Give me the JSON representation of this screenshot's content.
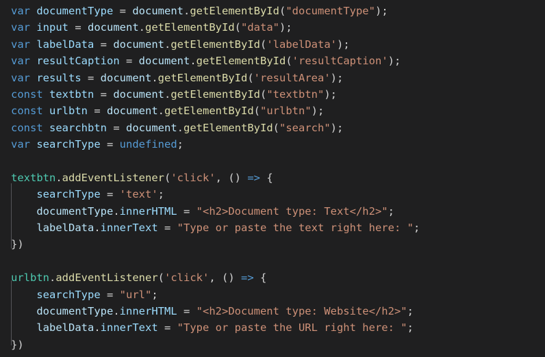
{
  "editor": {
    "language": "javascript",
    "background_color": "#1f1f20",
    "default_text_color": "#d4d4d4",
    "indent_guide_color": "#56565a",
    "font_size_px": 15.5,
    "line_height_px": 24.4,
    "theme_colors": {
      "keyword": "#569cd6",
      "variable": "#9cdcfe",
      "object": "#b9e3f7",
      "function": "#dcdcaa",
      "string": "#ce9178",
      "punctuation": "#d4d4d4",
      "receiver": "#4ec9b0",
      "arrow": "#569cd6"
    }
  },
  "code": {
    "lines": [
      {
        "n": 1,
        "text": "var documentType = document.getElementById(\"documentType\");",
        "tokens": [
          {
            "t": "var",
            "c": "kw"
          },
          {
            "t": " ",
            "c": "punc"
          },
          {
            "t": "documentType",
            "c": "var"
          },
          {
            "t": " = ",
            "c": "op"
          },
          {
            "t": "document",
            "c": "obj"
          },
          {
            "t": ".",
            "c": "punc"
          },
          {
            "t": "getElementById",
            "c": "fn"
          },
          {
            "t": "(",
            "c": "punc"
          },
          {
            "t": "\"documentType\"",
            "c": "str"
          },
          {
            "t": ");",
            "c": "punc"
          }
        ]
      },
      {
        "n": 2,
        "text": "var input = document.getElementById(\"data\");",
        "tokens": [
          {
            "t": "var",
            "c": "kw"
          },
          {
            "t": " ",
            "c": "punc"
          },
          {
            "t": "input",
            "c": "var"
          },
          {
            "t": " = ",
            "c": "op"
          },
          {
            "t": "document",
            "c": "obj"
          },
          {
            "t": ".",
            "c": "punc"
          },
          {
            "t": "getElementById",
            "c": "fn"
          },
          {
            "t": "(",
            "c": "punc"
          },
          {
            "t": "\"data\"",
            "c": "str"
          },
          {
            "t": ");",
            "c": "punc"
          }
        ]
      },
      {
        "n": 3,
        "text": "var labelData = document.getElementById('labelData');",
        "tokens": [
          {
            "t": "var",
            "c": "kw"
          },
          {
            "t": " ",
            "c": "punc"
          },
          {
            "t": "labelData",
            "c": "var"
          },
          {
            "t": " = ",
            "c": "op"
          },
          {
            "t": "document",
            "c": "obj"
          },
          {
            "t": ".",
            "c": "punc"
          },
          {
            "t": "getElementById",
            "c": "fn"
          },
          {
            "t": "(",
            "c": "punc"
          },
          {
            "t": "'labelData'",
            "c": "str"
          },
          {
            "t": ");",
            "c": "punc"
          }
        ]
      },
      {
        "n": 4,
        "text": "var resultCaption = document.getElementById('resultCaption');",
        "tokens": [
          {
            "t": "var",
            "c": "kw"
          },
          {
            "t": " ",
            "c": "punc"
          },
          {
            "t": "resultCaption",
            "c": "var"
          },
          {
            "t": " = ",
            "c": "op"
          },
          {
            "t": "document",
            "c": "obj"
          },
          {
            "t": ".",
            "c": "punc"
          },
          {
            "t": "getElementById",
            "c": "fn"
          },
          {
            "t": "(",
            "c": "punc"
          },
          {
            "t": "'resultCaption'",
            "c": "str"
          },
          {
            "t": ");",
            "c": "punc"
          }
        ]
      },
      {
        "n": 5,
        "text": "var results = document.getElementById('resultArea');",
        "tokens": [
          {
            "t": "var",
            "c": "kw"
          },
          {
            "t": " ",
            "c": "punc"
          },
          {
            "t": "results",
            "c": "var"
          },
          {
            "t": " = ",
            "c": "op"
          },
          {
            "t": "document",
            "c": "obj"
          },
          {
            "t": ".",
            "c": "punc"
          },
          {
            "t": "getElementById",
            "c": "fn"
          },
          {
            "t": "(",
            "c": "punc"
          },
          {
            "t": "'resultArea'",
            "c": "str"
          },
          {
            "t": ");",
            "c": "punc"
          }
        ]
      },
      {
        "n": 6,
        "text": "const textbtn = document.getElementById(\"textbtn\");",
        "tokens": [
          {
            "t": "const",
            "c": "kw"
          },
          {
            "t": " ",
            "c": "punc"
          },
          {
            "t": "textbtn",
            "c": "var"
          },
          {
            "t": " = ",
            "c": "op"
          },
          {
            "t": "document",
            "c": "obj"
          },
          {
            "t": ".",
            "c": "punc"
          },
          {
            "t": "getElementById",
            "c": "fn"
          },
          {
            "t": "(",
            "c": "punc"
          },
          {
            "t": "\"textbtn\"",
            "c": "str"
          },
          {
            "t": ");",
            "c": "punc"
          }
        ]
      },
      {
        "n": 7,
        "text": "const urlbtn = document.getElementById(\"urlbtn\");",
        "tokens": [
          {
            "t": "const",
            "c": "kw"
          },
          {
            "t": " ",
            "c": "punc"
          },
          {
            "t": "urlbtn",
            "c": "var"
          },
          {
            "t": " = ",
            "c": "op"
          },
          {
            "t": "document",
            "c": "obj"
          },
          {
            "t": ".",
            "c": "punc"
          },
          {
            "t": "getElementById",
            "c": "fn"
          },
          {
            "t": "(",
            "c": "punc"
          },
          {
            "t": "\"urlbtn\"",
            "c": "str"
          },
          {
            "t": ");",
            "c": "punc"
          }
        ]
      },
      {
        "n": 8,
        "text": "const searchbtn = document.getElementById(\"search\");",
        "tokens": [
          {
            "t": "const",
            "c": "kw"
          },
          {
            "t": " ",
            "c": "punc"
          },
          {
            "t": "searchbtn",
            "c": "var"
          },
          {
            "t": " = ",
            "c": "op"
          },
          {
            "t": "document",
            "c": "obj"
          },
          {
            "t": ".",
            "c": "punc"
          },
          {
            "t": "getElementById",
            "c": "fn"
          },
          {
            "t": "(",
            "c": "punc"
          },
          {
            "t": "\"search\"",
            "c": "str"
          },
          {
            "t": ");",
            "c": "punc"
          }
        ]
      },
      {
        "n": 9,
        "text": "var searchType = undefined;",
        "tokens": [
          {
            "t": "var",
            "c": "kw"
          },
          {
            "t": " ",
            "c": "punc"
          },
          {
            "t": "searchType",
            "c": "var"
          },
          {
            "t": " = ",
            "c": "op"
          },
          {
            "t": "undefined",
            "c": "kw"
          },
          {
            "t": ";",
            "c": "punc"
          }
        ]
      },
      {
        "n": 10,
        "text": "",
        "tokens": []
      },
      {
        "n": 11,
        "text": "textbtn.addEventListener('click', () => {",
        "tokens": [
          {
            "t": "textbtn",
            "c": "cyan"
          },
          {
            "t": ".",
            "c": "punc"
          },
          {
            "t": "addEventListener",
            "c": "fn"
          },
          {
            "t": "(",
            "c": "punc"
          },
          {
            "t": "'click'",
            "c": "str"
          },
          {
            "t": ", () ",
            "c": "punc"
          },
          {
            "t": "=>",
            "c": "arrow"
          },
          {
            "t": " {",
            "c": "punc"
          }
        ]
      },
      {
        "n": 12,
        "text": "    searchType = 'text';",
        "tokens": [
          {
            "t": "    ",
            "c": "punc"
          },
          {
            "t": "searchType",
            "c": "var"
          },
          {
            "t": " = ",
            "c": "op"
          },
          {
            "t": "'text'",
            "c": "str"
          },
          {
            "t": ";",
            "c": "punc"
          }
        ]
      },
      {
        "n": 13,
        "text": "    documentType.innerHTML = \"<h2>Document type: Text</h2>\";",
        "tokens": [
          {
            "t": "    ",
            "c": "punc"
          },
          {
            "t": "documentType",
            "c": "obj"
          },
          {
            "t": ".",
            "c": "punc"
          },
          {
            "t": "innerHTML",
            "c": "var"
          },
          {
            "t": " = ",
            "c": "op"
          },
          {
            "t": "\"<h2>Document type: Text</h2>\"",
            "c": "str"
          },
          {
            "t": ";",
            "c": "punc"
          }
        ]
      },
      {
        "n": 14,
        "text": "    labelData.innerText = \"Type or paste the text right here: \";",
        "tokens": [
          {
            "t": "    ",
            "c": "punc"
          },
          {
            "t": "labelData",
            "c": "obj"
          },
          {
            "t": ".",
            "c": "punc"
          },
          {
            "t": "innerText",
            "c": "var"
          },
          {
            "t": " = ",
            "c": "op"
          },
          {
            "t": "\"Type or paste the text right here: \"",
            "c": "str"
          },
          {
            "t": ";",
            "c": "punc"
          }
        ]
      },
      {
        "n": 15,
        "text": "})",
        "tokens": [
          {
            "t": "})",
            "c": "punc"
          }
        ]
      },
      {
        "n": 16,
        "text": "",
        "tokens": []
      },
      {
        "n": 17,
        "text": "urlbtn.addEventListener('click', () => {",
        "tokens": [
          {
            "t": "urlbtn",
            "c": "cyan"
          },
          {
            "t": ".",
            "c": "punc"
          },
          {
            "t": "addEventListener",
            "c": "fn"
          },
          {
            "t": "(",
            "c": "punc"
          },
          {
            "t": "'click'",
            "c": "str"
          },
          {
            "t": ", () ",
            "c": "punc"
          },
          {
            "t": "=>",
            "c": "arrow"
          },
          {
            "t": " {",
            "c": "punc"
          }
        ]
      },
      {
        "n": 18,
        "text": "    searchType = \"url\";",
        "tokens": [
          {
            "t": "    ",
            "c": "punc"
          },
          {
            "t": "searchType",
            "c": "var"
          },
          {
            "t": " = ",
            "c": "op"
          },
          {
            "t": "\"url\"",
            "c": "str"
          },
          {
            "t": ";",
            "c": "punc"
          }
        ]
      },
      {
        "n": 19,
        "text": "    documentType.innerHTML = \"<h2>Document type: Website</h2>\";",
        "tokens": [
          {
            "t": "    ",
            "c": "punc"
          },
          {
            "t": "documentType",
            "c": "obj"
          },
          {
            "t": ".",
            "c": "punc"
          },
          {
            "t": "innerHTML",
            "c": "var"
          },
          {
            "t": " = ",
            "c": "op"
          },
          {
            "t": "\"<h2>Document type: Website</h2>\"",
            "c": "str"
          },
          {
            "t": ";",
            "c": "punc"
          }
        ]
      },
      {
        "n": 20,
        "text": "    labelData.innerText = \"Type or paste the URL right here: \";",
        "tokens": [
          {
            "t": "    ",
            "c": "punc"
          },
          {
            "t": "labelData",
            "c": "obj"
          },
          {
            "t": ".",
            "c": "punc"
          },
          {
            "t": "innerText",
            "c": "var"
          },
          {
            "t": " = ",
            "c": "op"
          },
          {
            "t": "\"Type or paste the URL right here: \"",
            "c": "str"
          },
          {
            "t": ";",
            "c": "punc"
          }
        ]
      },
      {
        "n": 21,
        "text": "})",
        "tokens": [
          {
            "t": "})",
            "c": "punc"
          }
        ]
      }
    ]
  }
}
